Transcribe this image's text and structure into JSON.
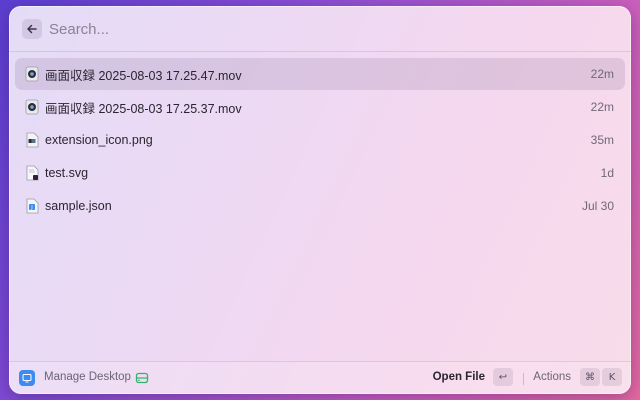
{
  "search": {
    "placeholder": "Search...",
    "value": ""
  },
  "results": [
    {
      "name": "画面収録 2025-08-03 17.25.47.mov",
      "time": "22m",
      "icon": "video-file-icon",
      "selected": true
    },
    {
      "name": "画面収録 2025-08-03 17.25.37.mov",
      "time": "22m",
      "icon": "video-file-icon",
      "selected": false
    },
    {
      "name": "extension_icon.png",
      "time": "35m",
      "icon": "image-file-icon",
      "selected": false
    },
    {
      "name": "test.svg",
      "time": "1d",
      "icon": "svg-file-icon",
      "selected": false
    },
    {
      "name": "sample.json",
      "time": "Jul 30",
      "icon": "json-file-icon",
      "selected": false
    }
  ],
  "footer": {
    "title": "Manage Desktop",
    "primary_action": "Open File",
    "primary_shortcut": "↩",
    "actions_label": "Actions",
    "actions_shortcut_mod": "⌘",
    "actions_shortcut_key": "K"
  },
  "colors": {
    "accent": "#3d8bf0",
    "status_green": "#2fb36a"
  }
}
